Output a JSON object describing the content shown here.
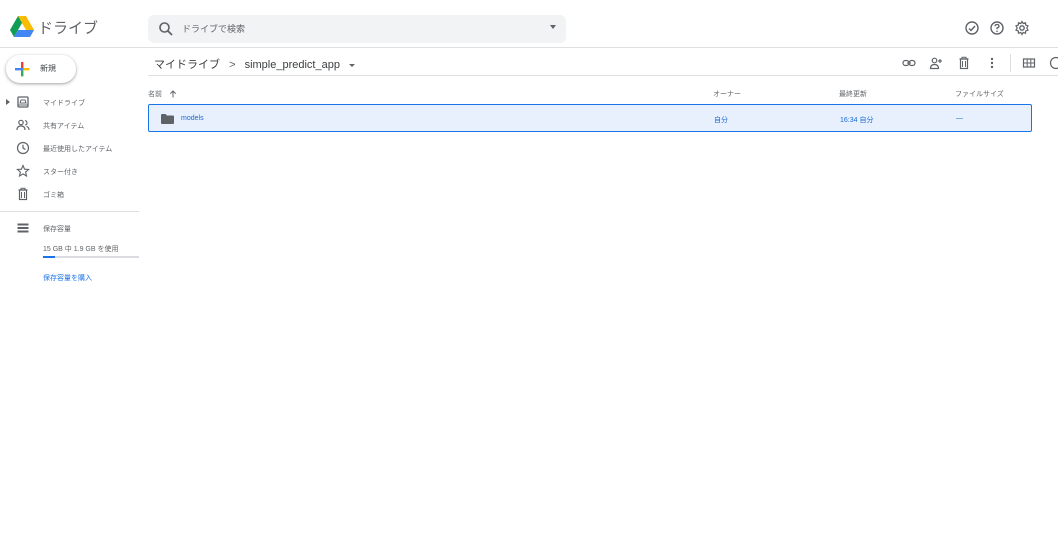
{
  "header": {
    "app_title": "ドライブ",
    "search_placeholder": "ドライブで検索"
  },
  "sidebar": {
    "new_label": "新規",
    "items": [
      {
        "label": "マイドライブ",
        "icon": "my-drive-icon"
      },
      {
        "label": "共有アイテム",
        "icon": "shared-icon"
      },
      {
        "label": "最近使用したアイテム",
        "icon": "recent-icon"
      },
      {
        "label": "スター付き",
        "icon": "star-icon"
      },
      {
        "label": "ゴミ箱",
        "icon": "trash-icon"
      }
    ],
    "storage": {
      "label": "保存容量",
      "usage_text": "15 GB 中 1.9 GB を使用",
      "used_fraction": 0.13,
      "buy_label": "保存容量を購入"
    }
  },
  "breadcrumb": {
    "root": "マイドライブ",
    "separator": ">",
    "current": "simple_predict_app"
  },
  "table": {
    "columns": {
      "name": "名前",
      "owner": "オーナー",
      "modified": "最終更新",
      "size": "ファイルサイズ"
    },
    "rows": [
      {
        "name": "models",
        "owner": "自分",
        "modified": "16:34 自分",
        "size": "—"
      }
    ]
  },
  "colors": {
    "accent": "#1a73e8",
    "selected_bg": "#e8f0fe"
  }
}
